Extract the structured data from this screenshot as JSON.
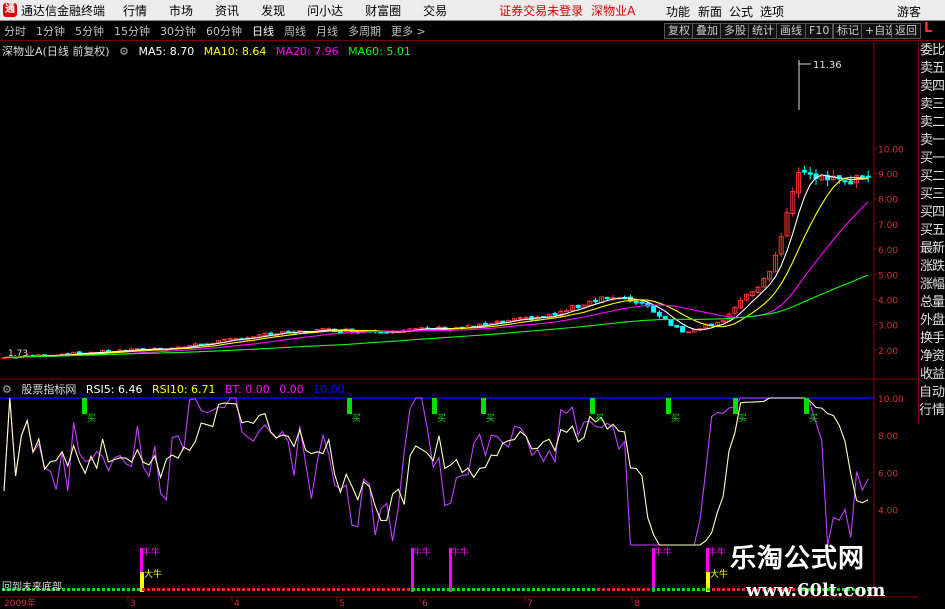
{
  "app": {
    "title": "通达信金融终端",
    "logo_text": "通"
  },
  "menu": [
    "行情",
    "市场",
    "资讯",
    "发现",
    "问小达",
    "财富圈",
    "交易"
  ],
  "alert": "证券交易未登录",
  "stock_link": "深物业A",
  "right_menu": [
    "功能",
    "新面",
    "公式",
    "选项",
    "游客"
  ],
  "toolbar": {
    "periods": [
      "分时",
      "1分钟",
      "5分钟",
      "15分钟",
      "30分钟",
      "60分钟",
      "日线",
      "周线",
      "月线",
      "多周期",
      "更多 >"
    ],
    "active": "日线",
    "buttons": [
      "复权",
      "叠加",
      "多股",
      "统计",
      "画线",
      "F10",
      "标记",
      "+自选",
      "返回"
    ],
    "corner": "L"
  },
  "main_legend": {
    "title": "深物业A(日线 前复权)",
    "items": [
      {
        "label": "MA5: 8.70",
        "color": "#ffffff"
      },
      {
        "label": "MA10: 8.64",
        "color": "#ffff00"
      },
      {
        "label": "MA20: 7.96",
        "color": "#ff00ff"
      },
      {
        "label": "MA60: 5.01",
        "color": "#00ff00"
      }
    ]
  },
  "main_yticks": [
    "10.00",
    "9.00",
    "8.00",
    "7.00",
    "6.00",
    "5.00",
    "4.00",
    "3.00",
    "2.00"
  ],
  "high_label": "11.36",
  "low_label": "1.73",
  "side_panel": [
    "委比",
    "卖五",
    "卖四",
    "卖三",
    "卖二",
    "卖一",
    "买一",
    "买二",
    "买三",
    "买四",
    "买五",
    "最新",
    "涨跌",
    "涨幅",
    "总量",
    "外盘",
    "换手",
    "净资",
    "收益"
  ],
  "side_panel2": [
    "自动",
    "行情"
  ],
  "indicator": {
    "title": "股票指标网",
    "items": [
      {
        "label": "RSI5: 6.46",
        "color": "#ffffff"
      },
      {
        "label": "RSI10: 6.71",
        "color": "#ffff00"
      },
      {
        "label": "BT: 0.00",
        "color": "#ff00ff"
      },
      {
        "label": "0.00",
        "color": "#ff00ff"
      },
      {
        "label": "10.00",
        "color": "#0000ff"
      }
    ],
    "yticks": [
      "10.00",
      "8.00",
      "6.00",
      "4.00"
    ],
    "bottom_label": "回到未来底部"
  },
  "signals": {
    "buy": "买",
    "strong": "牛牛",
    "big": "大牛"
  },
  "xaxis": [
    "2009年",
    "3",
    "4",
    "5",
    "6",
    "7",
    "8"
  ],
  "watermark": {
    "line1": "乐淘公式网",
    "line2": "www.60lt.com"
  },
  "colors": {
    "up": "#ff3232",
    "down": "#00ffff",
    "ma5": "#ffffff",
    "ma10": "#ffff00",
    "ma20": "#ff00ff",
    "ma60": "#00ff00",
    "frame": "#8b0000"
  }
}
